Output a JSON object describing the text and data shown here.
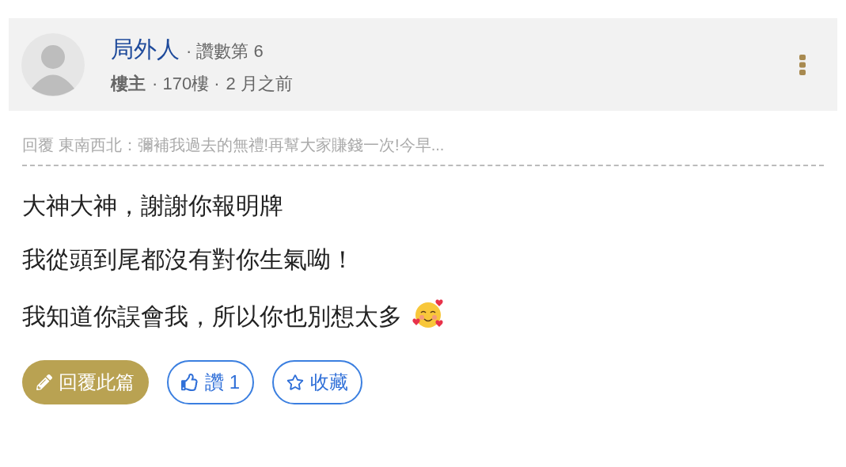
{
  "post": {
    "author": "局外人",
    "like_rank": "· 讚數第 6",
    "role": "樓主",
    "floor": "· 170樓 ·",
    "time": "2 月之前"
  },
  "reply_quote": "回覆 東南西北：彌補我過去的無禮!再幫大家賺錢一次!今早...",
  "body": [
    "大神大神，謝謝你報明牌",
    "我從頭到尾都沒有對你生氣呦！",
    "我知道你誤會我，所以你也別想太多"
  ],
  "actions": [
    {
      "kind": "reply",
      "label": "回覆此篇"
    },
    {
      "kind": "like",
      "label": "讚 1"
    },
    {
      "kind": "save",
      "label": "收藏"
    }
  ]
}
